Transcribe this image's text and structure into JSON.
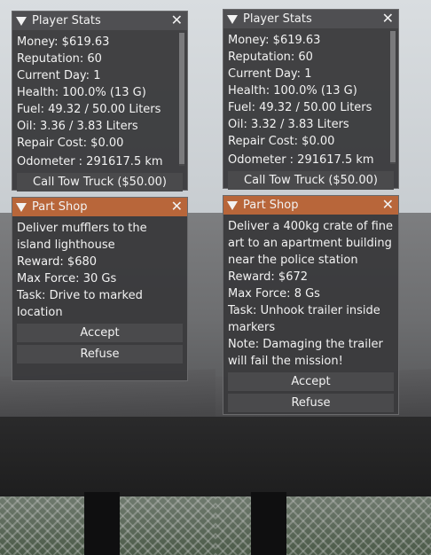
{
  "left": {
    "stats": {
      "title": "Player Stats",
      "money": "Money: $619.63",
      "reputation": "Reputation: 60",
      "day": "Current Day: 1",
      "health": "Health: 100.0% (13 G)",
      "fuel": "Fuel: 49.32 / 50.00 Liters",
      "oil": "Oil: 3.36 / 3.83 Liters",
      "repair": "Repair Cost: $0.00",
      "odometer": "Odometer : 291617.5 km",
      "tow_button": "Call Tow Truck ($50.00)"
    },
    "shop": {
      "title": "Part Shop",
      "description": "Deliver mufflers to the island lighthouse",
      "reward": "Reward: $680",
      "max_force": "Max Force: 30 Gs",
      "task": "Task: Drive to marked location",
      "accept": "Accept",
      "refuse": "Refuse"
    }
  },
  "right": {
    "stats": {
      "title": "Player Stats",
      "money": "Money: $619.63",
      "reputation": "Reputation: 60",
      "day": "Current Day: 1",
      "health": "Health: 100.0% (13 G)",
      "fuel": "Fuel: 49.32 / 50.00 Liters",
      "oil": "Oil: 3.32 / 3.83 Liters",
      "repair": "Repair Cost: $0.00",
      "odometer": "Odometer : 291617.5 km",
      "tow_button": "Call Tow Truck ($50.00)"
    },
    "shop": {
      "title": "Part Shop",
      "description": "Deliver a 400kg crate of fine art to an apartment building near the police station",
      "reward": "Reward: $672",
      "max_force": "Max Force: 8 Gs",
      "task": "Task: Unhook trailer inside markers",
      "note": "Note: Damaging the trailer will fail the mission!",
      "accept": "Accept",
      "refuse": "Refuse"
    }
  },
  "icons": {
    "collapse": "triangle-down-icon",
    "close": "close-x-icon"
  },
  "colors": {
    "panel_bg": "#3a3a3c",
    "stats_title_bg": "#4f4f52",
    "shop_title_bg": "#b8663a",
    "button_bg": "#4a4a4c",
    "text": "#f2f2f2"
  }
}
